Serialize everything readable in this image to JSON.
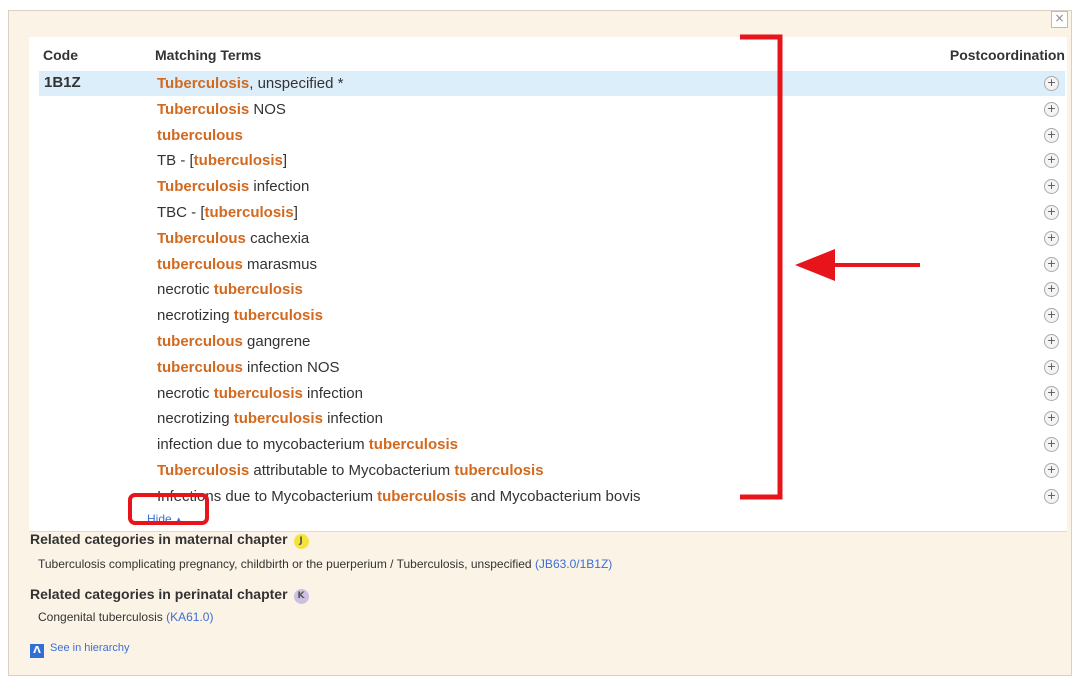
{
  "close_icon": "×",
  "headers": {
    "code": "Code",
    "terms": "Matching Terms",
    "postcoordination": "Postcoordination"
  },
  "rows": [
    {
      "code": "1B1Z",
      "parts": [
        {
          "t": "Tuberculosis",
          "h": true
        },
        {
          "t": ", unspecified *",
          "h": false
        }
      ],
      "selected": true
    },
    {
      "code": "",
      "parts": [
        {
          "t": "Tuberculosis",
          "h": true
        },
        {
          "t": " NOS",
          "h": false
        }
      ]
    },
    {
      "code": "",
      "parts": [
        {
          "t": "tuberculous",
          "h": true
        }
      ]
    },
    {
      "code": "",
      "parts": [
        {
          "t": "TB - [",
          "h": false
        },
        {
          "t": "tuberculosis",
          "h": true
        },
        {
          "t": "]",
          "h": false
        }
      ]
    },
    {
      "code": "",
      "parts": [
        {
          "t": "Tuberculosis",
          "h": true
        },
        {
          "t": " infection",
          "h": false
        }
      ]
    },
    {
      "code": "",
      "parts": [
        {
          "t": "TBC - [",
          "h": false
        },
        {
          "t": "tuberculosis",
          "h": true
        },
        {
          "t": "]",
          "h": false
        }
      ]
    },
    {
      "code": "",
      "parts": [
        {
          "t": "Tuberculous",
          "h": true
        },
        {
          "t": " cachexia",
          "h": false
        }
      ]
    },
    {
      "code": "",
      "parts": [
        {
          "t": "tuberculous",
          "h": true
        },
        {
          "t": " marasmus",
          "h": false
        }
      ]
    },
    {
      "code": "",
      "parts": [
        {
          "t": "necrotic ",
          "h": false
        },
        {
          "t": "tuberculosis",
          "h": true
        }
      ]
    },
    {
      "code": "",
      "parts": [
        {
          "t": "necrotizing ",
          "h": false
        },
        {
          "t": "tuberculosis",
          "h": true
        }
      ]
    },
    {
      "code": "",
      "parts": [
        {
          "t": "tuberculous",
          "h": true
        },
        {
          "t": " gangrene",
          "h": false
        }
      ]
    },
    {
      "code": "",
      "parts": [
        {
          "t": "tuberculous",
          "h": true
        },
        {
          "t": " infection NOS",
          "h": false
        }
      ]
    },
    {
      "code": "",
      "parts": [
        {
          "t": "necrotic ",
          "h": false
        },
        {
          "t": "tuberculosis",
          "h": true
        },
        {
          "t": " infection",
          "h": false
        }
      ]
    },
    {
      "code": "",
      "parts": [
        {
          "t": "necrotizing ",
          "h": false
        },
        {
          "t": "tuberculosis",
          "h": true
        },
        {
          "t": " infection",
          "h": false
        }
      ]
    },
    {
      "code": "",
      "parts": [
        {
          "t": "infection due to mycobacterium ",
          "h": false
        },
        {
          "t": "tuberculosis",
          "h": true
        }
      ]
    },
    {
      "code": "",
      "parts": [
        {
          "t": "Tuberculosis",
          "h": true
        },
        {
          "t": " attributable to Mycobacterium ",
          "h": false
        },
        {
          "t": "tuberculosis",
          "h": true
        }
      ]
    },
    {
      "code": "",
      "parts": [
        {
          "t": "Infections due to Mycobacterium ",
          "h": false
        },
        {
          "t": "tuberculosis",
          "h": true
        },
        {
          "t": " and Mycobacterium bovis",
          "h": false
        }
      ]
    }
  ],
  "plus_icon": "+",
  "hide_label": "Hide",
  "hide_icon": "▲",
  "maternal": {
    "title": "Related categories in maternal chapter",
    "chip": "J",
    "text": "Tuberculosis complicating pregnancy, childbirth or the puerperium / Tuberculosis, unspecified",
    "link": "(JB63.0/1B1Z)"
  },
  "perinatal": {
    "title": "Related categories in perinatal chapter",
    "chip": "K",
    "text": "Congenital tuberculosis",
    "link": "(KA61.0)"
  },
  "hierarchy": {
    "icon": "Λ",
    "label": "See in hierarchy"
  },
  "annotation_color": "#e8141b",
  "highlight_color": "#d2691e"
}
